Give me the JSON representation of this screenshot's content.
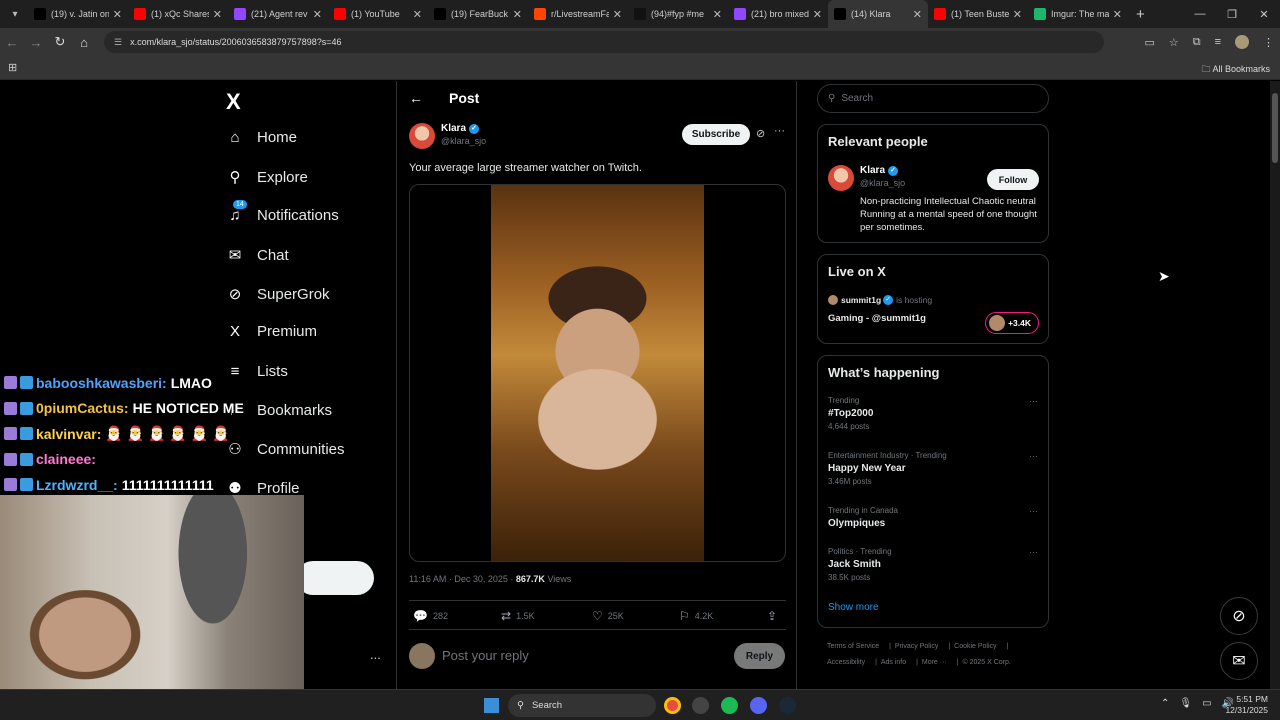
{
  "browser": {
    "tabs": [
      {
        "title": "(19) v. Jatin on",
        "icon": "x-logo-icon",
        "color": "#000000"
      },
      {
        "title": "(1) xQc Shares",
        "icon": "youtube-icon",
        "color": "#ff0000"
      },
      {
        "title": "(21) Agent rev",
        "icon": "twitch-icon",
        "color": "#9146ff"
      },
      {
        "title": "(1) YouTube",
        "icon": "youtube-icon",
        "color": "#ff0000"
      },
      {
        "title": "(19) FearBuck",
        "icon": "x-logo-icon",
        "color": "#000000"
      },
      {
        "title": "r/LivestreamFa",
        "icon": "reddit-icon",
        "color": "#ff4500"
      },
      {
        "title": "(94)#fyp #me",
        "icon": "tiktok-icon",
        "color": "#111111"
      },
      {
        "title": "(21) bro mixed",
        "icon": "twitch-icon",
        "color": "#9146ff"
      },
      {
        "title": "(14) Klara",
        "icon": "x-logo-icon",
        "color": "#000000",
        "active": true
      },
      {
        "title": "(1) Teen Buste",
        "icon": "youtube-icon",
        "color": "#ff0000"
      },
      {
        "title": "Imgur: The ma",
        "icon": "imgur-icon",
        "color": "#1bb76e"
      }
    ],
    "new_tab": "+",
    "url": "x.com/klara_sjo/status/2006036583879757898?s=46",
    "bookmarks_label": "All Bookmarks"
  },
  "sidebar": {
    "logo": "X",
    "items": [
      {
        "label": "Home",
        "icon": "home-icon",
        "glyph": "⌂"
      },
      {
        "label": "Explore",
        "icon": "search-icon",
        "glyph": "⚲"
      },
      {
        "label": "Notifications",
        "icon": "bell-icon",
        "glyph": "♫",
        "badge": "14"
      },
      {
        "label": "Chat",
        "icon": "mail-icon",
        "glyph": "✉"
      },
      {
        "label": "SuperGrok",
        "icon": "grok-icon",
        "glyph": "⊘"
      },
      {
        "label": "Premium",
        "icon": "x-logo-icon",
        "glyph": "X"
      },
      {
        "label": "Lists",
        "icon": "list-icon",
        "glyph": "≡"
      },
      {
        "label": "Bookmarks",
        "icon": "bookmark-icon",
        "glyph": "⚐"
      },
      {
        "label": "Communities",
        "icon": "communities-icon",
        "glyph": "⚇"
      },
      {
        "label": "Profile",
        "icon": "profile-icon",
        "glyph": "⚉"
      }
    ],
    "more": "..."
  },
  "post": {
    "header_title": "Post",
    "author_name": "Klara",
    "author_handle": "@klara_sjo",
    "subscribe_label": "Subscribe",
    "text": "Your average large streamer watcher on Twitch.",
    "timestamp": "11:16 AM · Dec 30, 2025 · ",
    "views_count": "867.7K",
    "views_label": " Views",
    "replies": "282",
    "reposts": "1.5K",
    "likes": "25K",
    "bookmarks": "4.2K",
    "reply_placeholder": "Post your reply",
    "reply_button": "Reply"
  },
  "right": {
    "search_placeholder": "Search",
    "relevant": {
      "title": "Relevant people",
      "name": "Klara",
      "handle": "@klara_sjo",
      "follow_label": "Follow",
      "bio": "Non-practicing Intellectual Chaotic neutral Running at a mental speed of one thought per sometimes."
    },
    "live": {
      "title": "Live on X",
      "host": "summit1g",
      "hosting_text": "is hosting",
      "stream_title": "Gaming - @summit1g",
      "viewers": "+3.4K"
    },
    "happening": {
      "title": "What’s happening",
      "trends": [
        {
          "context": "Trending",
          "title": "#Top2000",
          "count": "4,644 posts"
        },
        {
          "context": "Entertainment Industry · Trending",
          "title": "Happy New Year",
          "count": "3.46M posts"
        },
        {
          "context": "Trending in Canada",
          "title": "Olympiques",
          "count": ""
        },
        {
          "context": "Politics · Trending",
          "title": "Jack Smith",
          "count": "38.5K posts"
        }
      ],
      "show_more": "Show more"
    },
    "footer": {
      "line1": [
        "Terms of Service",
        "Privacy Policy",
        "Cookie Policy"
      ],
      "line2": [
        "Accessibility",
        "Ads info",
        "More ···",
        "© 2025 X Corp."
      ]
    }
  },
  "chat": [
    {
      "user": "babooshkawasberi:",
      "msg": "LMAO",
      "color": "#4fa3ff"
    },
    {
      "user": "0piumCactus:",
      "msg": "HE NOTICED ME",
      "color": "#f5c242"
    },
    {
      "user": "kalvinvar:",
      "msg": "🎅 🎅 🎅 🎅 🎅 🎅",
      "color": "#ffd24a"
    },
    {
      "user": "claineee:",
      "msg": "",
      "color": "#ff7ad0"
    },
    {
      "user": "Lzrdwzrd__:",
      "msg": "1111111111111",
      "color": "#4fb3ff"
    }
  ],
  "taskbar": {
    "search_label": "Search",
    "time": "5:51 PM",
    "date": "12/31/2025"
  }
}
